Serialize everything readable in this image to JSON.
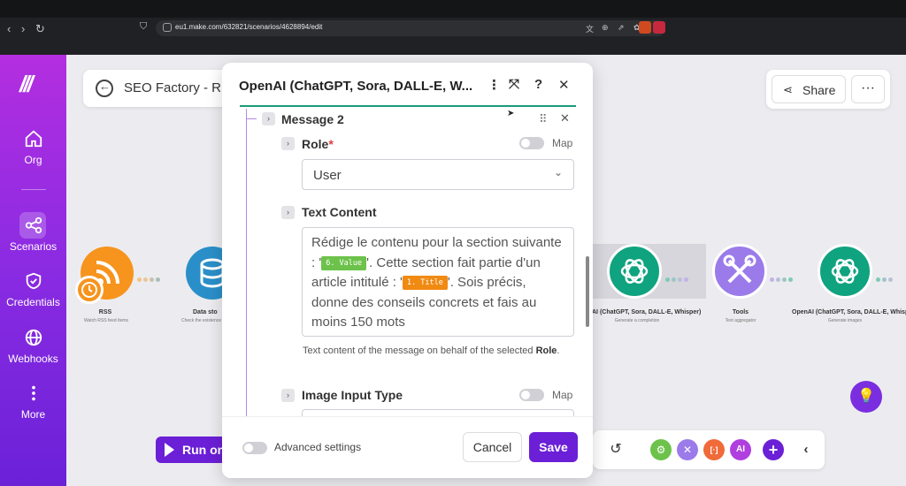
{
  "browser": {
    "url": "eu1.make.com/632821/scenarios/4628894/edit"
  },
  "sidebar": {
    "items": [
      {
        "label": "Org",
        "icon": "home-icon"
      },
      {
        "label": "Scenarios",
        "icon": "share-nodes-icon"
      },
      {
        "label": "Credentials",
        "icon": "shield-icon"
      },
      {
        "label": "Webhooks",
        "icon": "globe-icon"
      },
      {
        "label": "More",
        "icon": "vertical-dots-icon"
      }
    ]
  },
  "scenario": {
    "title": "SEO Factory - R",
    "share_label": "Share",
    "more_label": "···"
  },
  "modules": [
    {
      "label": "RSS",
      "sub": "Watch RSS feed items",
      "color": "#f7941d"
    },
    {
      "label": "Data sto",
      "sub": "Check the existence of a",
      "color": "#2a8fc8"
    },
    {
      "label": "AI (ChatGPT, Sora, DALL-E, Whisper)",
      "sub": "Generate a completion",
      "color": "#10a37f"
    },
    {
      "label": "Tools",
      "sub": "Text aggregator",
      "color": "#9b7bea"
    },
    {
      "label": "OpenAI (ChatGPT, Sora, DALL-E, Whisper)",
      "sub": "Generate images",
      "color": "#10a37f"
    }
  ],
  "bottom": {
    "run_label": "Run one"
  },
  "modal": {
    "title": "OpenAI (ChatGPT, Sora, DALL-E, W...",
    "section_title": "Message 2",
    "role_label": "Role",
    "required_mark": "*",
    "map_label": "Map",
    "role_value": "User",
    "text_content_label": "Text Content",
    "content_part1": "Rédige le contenu pour la section suivante : '",
    "pill1": "6. Value",
    "content_part2": "'. Cette section fait partie d'un article intitulé : '",
    "pill2": "1. Title",
    "content_part3": "'. Sois précis, donne des conseils concrets et fais au moins 150 mots",
    "help_text": "Text content of the message on behalf of the selected",
    "help_bold": "Role",
    "help_end": ".",
    "image_input_label": "Image Input Type",
    "advanced_label": "Advanced settings",
    "cancel_label": "Cancel",
    "save_label": "Save"
  },
  "colors": {
    "accent": "#6b1fd6",
    "openai_green": "#10a37f",
    "rss_orange": "#f7941d",
    "pill_green": "#6cc24a",
    "pill_orange": "#f08a12"
  }
}
